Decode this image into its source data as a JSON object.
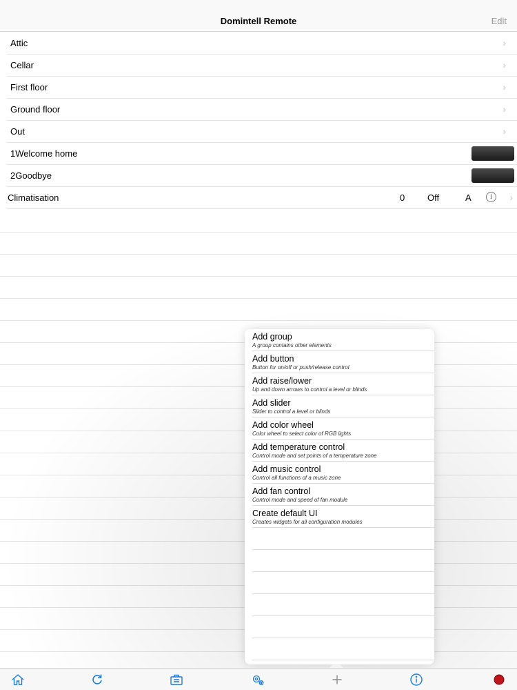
{
  "navbar": {
    "title": "Domintell Remote",
    "edit": "Edit"
  },
  "groups": [
    {
      "label": "Attic"
    },
    {
      "label": "Cellar"
    },
    {
      "label": "First floor"
    },
    {
      "label": "Ground floor"
    },
    {
      "label": "Out"
    }
  ],
  "scenes": [
    {
      "label": "1Welcome home"
    },
    {
      "label": "2Goodbye"
    }
  ],
  "climatisation": {
    "label": "Climatisation",
    "value": "0",
    "mode": "Off",
    "auto": "A"
  },
  "menu": [
    {
      "title": "Add group",
      "subtitle": "A group contains other elements"
    },
    {
      "title": "Add button",
      "subtitle": "Button for on/off or push/release control"
    },
    {
      "title": "Add raise/lower",
      "subtitle": "Up and down arrows to control a level or blinds"
    },
    {
      "title": "Add slider",
      "subtitle": "Slider to control a level or blinds"
    },
    {
      "title": "Add color wheel",
      "subtitle": "Color wheel to select color of RGB lights"
    },
    {
      "title": "Add temperature control",
      "subtitle": "Control mode and set points of a temperature zone"
    },
    {
      "title": "Add music control",
      "subtitle": "Control all functions of a music zone"
    },
    {
      "title": "Add fan control",
      "subtitle": "Control mode and speed of fan module"
    },
    {
      "title": "Create default UI",
      "subtitle": "Creates widgets for all configuration modules"
    }
  ],
  "tabbar": {
    "icons": [
      "home-icon",
      "refresh-icon",
      "briefcase-icon",
      "gears-icon",
      "plus-icon",
      "info-icon",
      "record-icon"
    ],
    "accent": "#1c7bd6",
    "record_color": "#c0161b"
  }
}
